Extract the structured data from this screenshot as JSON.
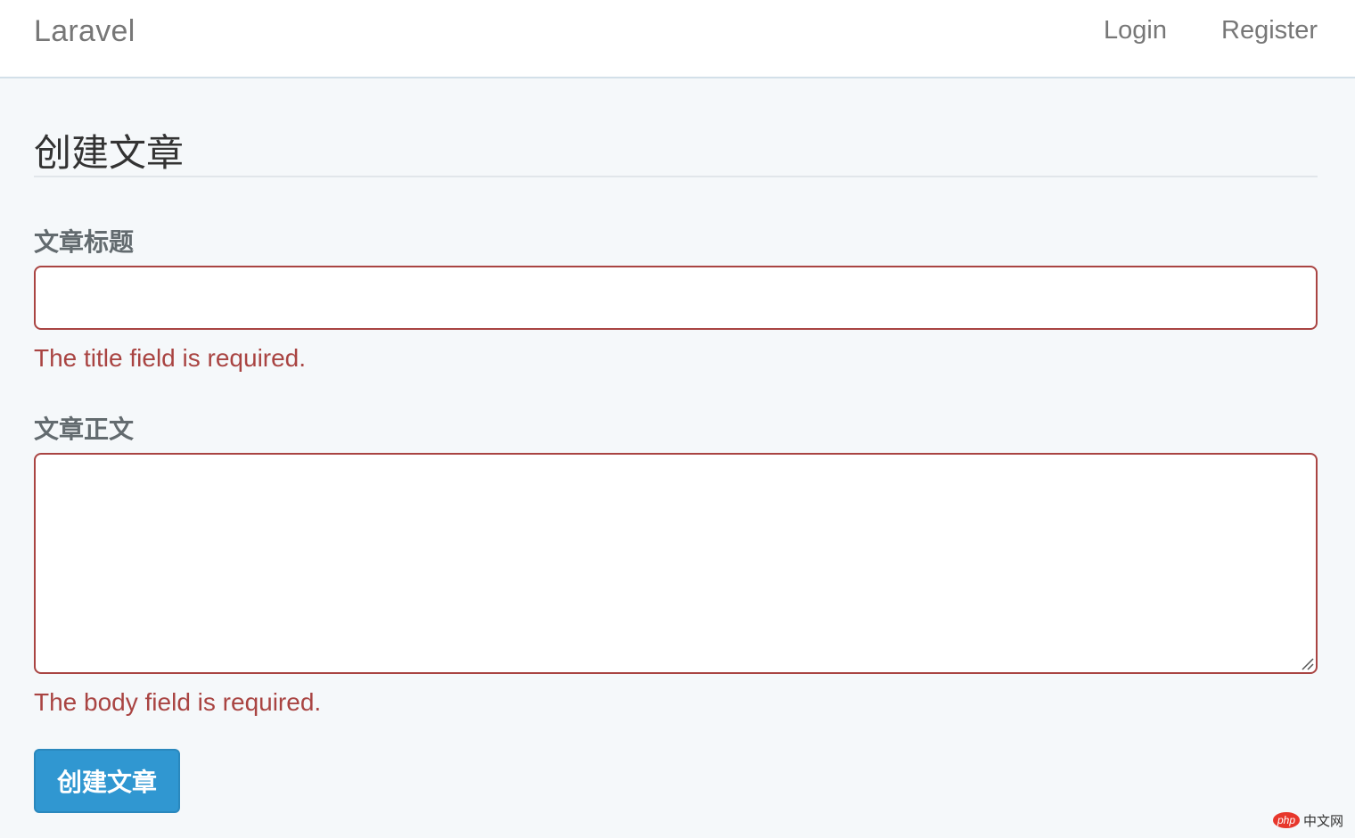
{
  "navbar": {
    "brand": "Laravel",
    "links": [
      "Login",
      "Register"
    ]
  },
  "page": {
    "title": "创建文章"
  },
  "form": {
    "title_field": {
      "label": "文章标题",
      "value": "",
      "error": "The title field is required."
    },
    "body_field": {
      "label": "文章正文",
      "value": "",
      "error": "The body field is required."
    },
    "submit_label": "创建文章"
  },
  "watermark": {
    "logo": "php",
    "text": "中文网"
  },
  "colors": {
    "error": "#a94442",
    "primary_button": "#3097d1",
    "page_background": "#f5f8fa"
  }
}
